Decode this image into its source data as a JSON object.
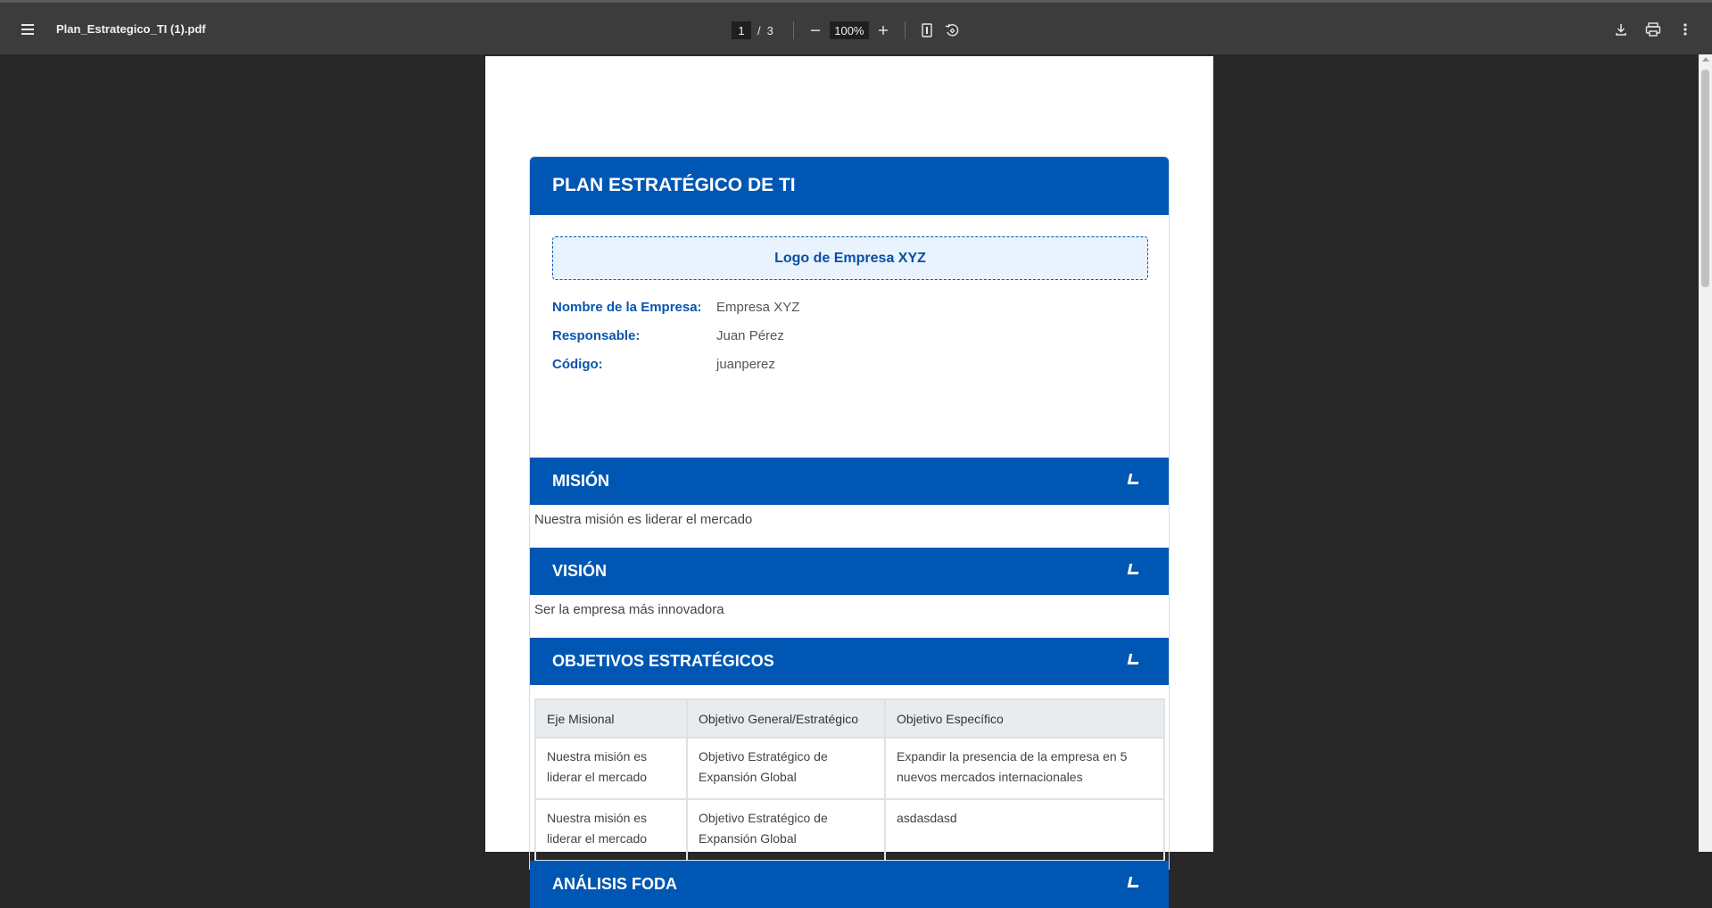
{
  "toolbar": {
    "file_title": "Plan_Estrategico_TI (1).pdf",
    "page_current": "1",
    "page_separator": "/",
    "page_total": "3",
    "zoom": "100%"
  },
  "document": {
    "title": "PLAN ESTRATÉGICO DE TI",
    "logo_text": "Logo de Empresa XYZ",
    "info": [
      {
        "label": "Nombre de la Empresa:",
        "value": "Empresa XYZ"
      },
      {
        "label": "Responsable:",
        "value": "Juan Pérez"
      },
      {
        "label": "Código:",
        "value": "juanperez"
      }
    ],
    "sections": {
      "mision": {
        "title": "MISIÓN",
        "text": "Nuestra misión es liderar el mercado"
      },
      "vision": {
        "title": "VISIÓN",
        "text": "Ser la empresa más innovadora"
      },
      "objetivos": {
        "title": "OBJETIVOS ESTRATÉGICOS"
      },
      "foda": {
        "title": "ANÁLISIS FODA"
      }
    },
    "table": {
      "headers": [
        "Eje Misional",
        "Objetivo General/Estratégico",
        "Objetivo Específico"
      ],
      "rows": [
        [
          "Nuestra misión es liderar el mercado",
          "Objetivo Estratégico de Expansión Global",
          "Expandir la presencia de la empresa en 5 nuevos mercados internacionales"
        ],
        [
          "Nuestra misión es liderar el mercado",
          "Objetivo Estratégico de Expansión Global",
          "asdasdasd"
        ]
      ]
    }
  },
  "colors": {
    "accent": "#0056b3",
    "toolbar_bg": "#3c3c3c",
    "viewer_bg": "#282828"
  },
  "icons": [
    "menu-icon",
    "zoom-out-icon",
    "zoom-in-icon",
    "fit-page-icon",
    "rotate-icon",
    "download-icon",
    "print-icon",
    "more-vert-icon",
    "chevron-icon"
  ]
}
